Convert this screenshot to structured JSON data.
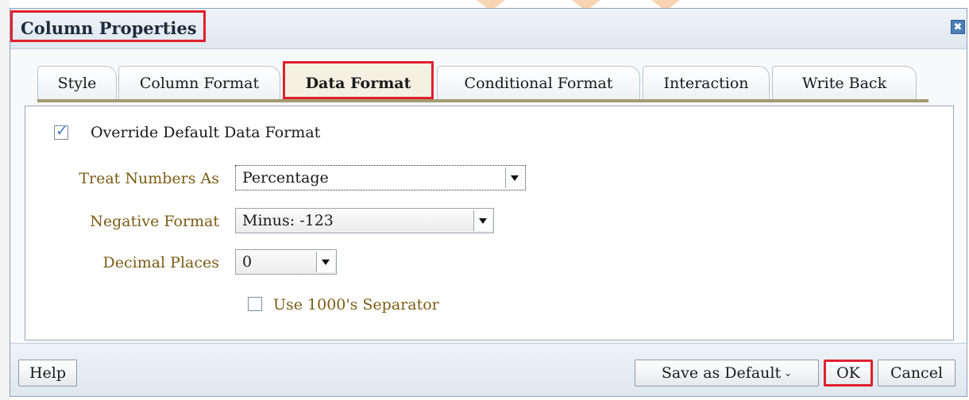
{
  "dialog": {
    "title": "Column Properties",
    "close_glyph": "✖"
  },
  "tabs": [
    {
      "label": "Style",
      "active": false
    },
    {
      "label": "Column Format",
      "active": false
    },
    {
      "label": "Data Format",
      "active": true
    },
    {
      "label": "Conditional Format",
      "active": false
    },
    {
      "label": "Interaction",
      "active": false
    },
    {
      "label": "Write Back",
      "active": false
    }
  ],
  "data_format": {
    "override": {
      "label": "Override Default Data Format",
      "checked": true
    },
    "treat_numbers_as": {
      "label": "Treat Numbers As",
      "value": "Percentage"
    },
    "negative_format": {
      "label": "Negative Format",
      "value": "Minus: -123"
    },
    "decimal_places": {
      "label": "Decimal Places",
      "value": "0"
    },
    "separator": {
      "label": "Use 1000's Separator",
      "checked": false
    }
  },
  "footer": {
    "help_label": "Help",
    "save_default_label": "Save as Default",
    "ok_label": "OK",
    "cancel_label": "Cancel"
  },
  "colors": {
    "highlight": "#e0202e",
    "field_label": "#7a5c14",
    "checkmark": "#3c78c8"
  }
}
